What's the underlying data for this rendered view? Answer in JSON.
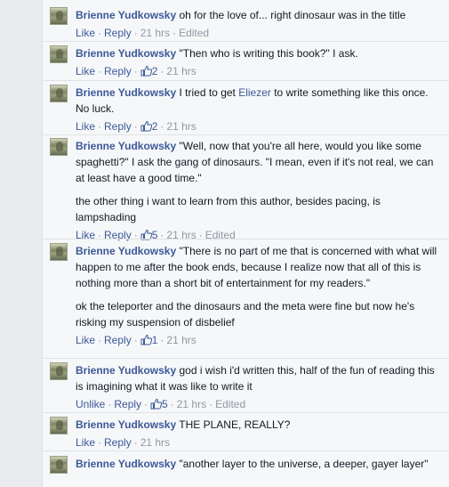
{
  "labels": {
    "like": "Like",
    "unlike": "Unlike",
    "reply": "Reply",
    "edited": "Edited",
    "sep": "·"
  },
  "icons": {
    "avatar": "avatar-photo",
    "like": "thumbs-up-icon"
  },
  "colors": {
    "link": "#3b5998",
    "meta": "#9197a3",
    "panel": "#f6f7f9"
  },
  "comments": [
    {
      "author": "Brienne Yudkowsky",
      "text": "oh for the love of... right dinosaur was in the title",
      "time": "21 hrs",
      "edited": true
    },
    {
      "author": "Brienne Yudkowsky",
      "text": "\"Then who is writing this book?\" I ask.",
      "likes": "2",
      "time": "21 hrs"
    },
    {
      "author": "Brienne Yudkowsky",
      "text_before": "I tried to get ",
      "mention": "Eliezer",
      "text_after": " to write something like this once. No luck.",
      "likes": "2",
      "time": "21 hrs"
    },
    {
      "author": "Brienne Yudkowsky",
      "text": "\"Well, now that you're all here, would you like some spaghetti?\" I ask the gang of dinosaurs. \"I mean, even if it's not real, we can at least have a good time.\"",
      "text2": "the other thing i want to learn from this author, besides pacing, is lampshading",
      "likes": "5",
      "time": "21 hrs",
      "edited": true
    },
    {
      "author": "Brienne Yudkowsky",
      "text": "\"There is no part of me that is concerned with what will happen to me after the book ends, because I realize now that all of this is nothing more than a short bit of entertainment for my readers.\"",
      "text2": "ok the teleporter and the dinosaurs and the meta were fine but now he's risking my suspension of disbelief",
      "likes": "1",
      "time": "21 hrs"
    },
    {
      "author": "Brienne Yudkowsky",
      "text": "god i wish i'd written this, half of the fun of reading this is imagining what it was like to write it",
      "liked": true,
      "likes": "5",
      "time": "21 hrs",
      "edited": true
    },
    {
      "author": "Brienne Yudkowsky",
      "text": "THE PLANE, REALLY?",
      "time": "21 hrs"
    },
    {
      "author": "Brienne Yudkowsky",
      "text": "\"another layer to the universe, a deeper, gayer layer\""
    }
  ]
}
